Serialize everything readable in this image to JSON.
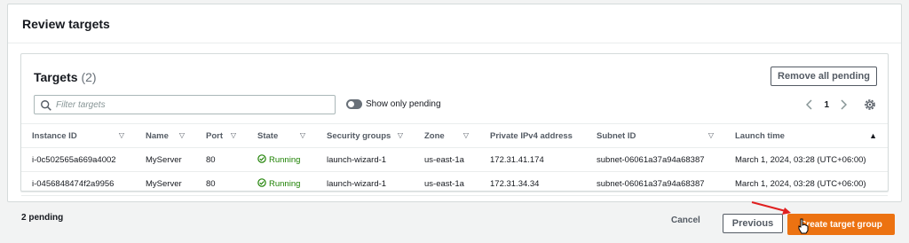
{
  "section": {
    "title": "Review targets"
  },
  "targets": {
    "title": "Targets",
    "count": "(2)",
    "remove_all_label": "Remove all pending",
    "filter_placeholder": "Filter targets",
    "toggle_label": "Show only pending",
    "page_number": "1"
  },
  "table": {
    "columns": [
      "Instance ID",
      "Name",
      "Port",
      "State",
      "Security groups",
      "Zone",
      "Private IPv4 address",
      "Subnet ID",
      "Launch time"
    ],
    "rows": [
      {
        "instance_id": "i-0c502565a669a4002",
        "name": "MyServer",
        "port": "80",
        "state": "Running",
        "security_group": "launch-wizard-1",
        "zone": "us-east-1a",
        "ipv4": "172.31.41.174",
        "subnet": "subnet-06061a37a94a68387",
        "launch_time": "March 1, 2024, 03:28 (UTC+06:00)"
      },
      {
        "instance_id": "i-0456848474f2a9956",
        "name": "MyServer",
        "port": "80",
        "state": "Running",
        "security_group": "launch-wizard-1",
        "zone": "us-east-1a",
        "ipv4": "172.31.34.34",
        "subnet": "subnet-06061a37a94a68387",
        "launch_time": "March 1, 2024, 03:28 (UTC+06:00)"
      }
    ]
  },
  "footer": {
    "pending": "2 pending",
    "cancel_label": "Cancel",
    "previous_label": "Previous",
    "create_label": "Create target group"
  },
  "colors": {
    "primary_button": "#ec7211",
    "running": "#1d8102",
    "annotation_arrow": "#e02020"
  }
}
